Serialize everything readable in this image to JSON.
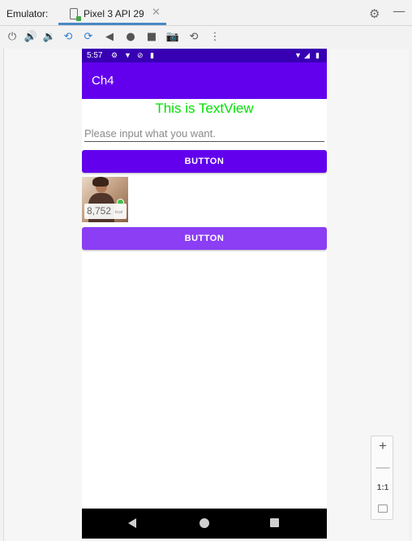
{
  "emulator": {
    "label": "Emulator:",
    "tab_label": "Pixel 3 API 29",
    "tab_close": "✕",
    "settings_icon": "gear-icon",
    "minimize_icon": "minimize-icon"
  },
  "toolbar": {
    "items": [
      "power-icon",
      "volume-up-icon",
      "volume-down-icon",
      "rotate-left-icon",
      "rotate-right-icon",
      "back-icon",
      "home-icon",
      "overview-icon",
      "screenshot-icon",
      "snapshot-icon",
      "more-icon"
    ]
  },
  "phone": {
    "status": {
      "time": "5:57"
    },
    "app_title": "Ch4",
    "textview": "This is TextView",
    "edittext_placeholder": "Please input what you want.",
    "button1_label": "BUTTON",
    "button2_label": "BUTTON",
    "thumbnail_number": "8,752",
    "thumbnail_unit": "kcal",
    "colors": {
      "status_bar": "#3700b3",
      "app_bar": "#6200ee",
      "textview": "#00e100",
      "button1": "#6200ee",
      "button2": "#8b3ef4"
    }
  },
  "zoom": {
    "zoom_in": "+",
    "zoom_out": "—",
    "actual_size": "1:1"
  }
}
